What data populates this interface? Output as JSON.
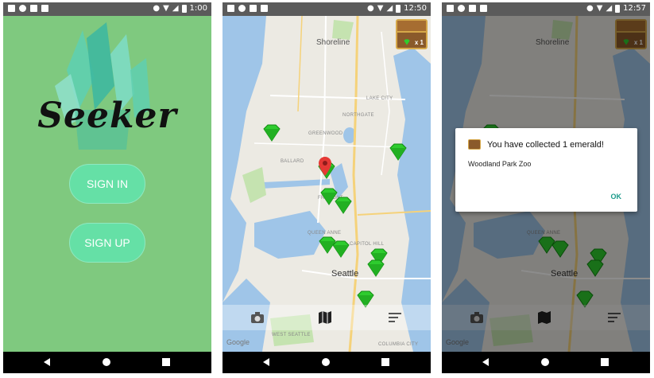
{
  "screen1": {
    "status_time": "1:00",
    "app_title": "Seeker",
    "sign_in_label": "SIGN IN",
    "sign_up_label": "SIGN UP"
  },
  "screen2": {
    "status_time": "12:50",
    "chest_count": "x 1",
    "map_labels": {
      "shoreline": "Shoreline",
      "seattle": "Seattle",
      "ballard": "BALLARD",
      "greenwood": "GREENWOOD",
      "northgate": "NORTHGATE",
      "lake_city": "LAKE CITY",
      "queen_anne": "QUEEN ANNE",
      "capitol_hill": "CAPITOL HILL",
      "fremont": "FREMONT",
      "west_seattle": "WEST SEATTLE",
      "columbia_city": "COLUMBIA CITY"
    },
    "google": "Google"
  },
  "screen3": {
    "status_time": "12:57",
    "chest_count": "x 1",
    "dialog_title": "You have collected 1 emerald!",
    "dialog_body": "Woodland Park Zoo",
    "dialog_ok": "OK",
    "map_labels": {
      "shoreline": "Shoreline",
      "seattle": "Seattle",
      "queen_anne": "QUEEN ANNE"
    },
    "google": "Google"
  },
  "icons": {
    "status_left": [
      "gallery-icon",
      "settings-circle-icon",
      "sd-card-icon",
      "debug-icon"
    ],
    "status_right": [
      "location-icon",
      "wifi-icon",
      "signal-icon",
      "battery-icon"
    ],
    "tabs": [
      "camera-icon",
      "map-icon",
      "list-icon"
    ]
  },
  "colors": {
    "splash_bg": "#7fc97f",
    "button": "#65e0a6",
    "emerald": "#2ecc2e",
    "water": "#9fc5e8",
    "dialog_accent": "#1a9b8a"
  }
}
